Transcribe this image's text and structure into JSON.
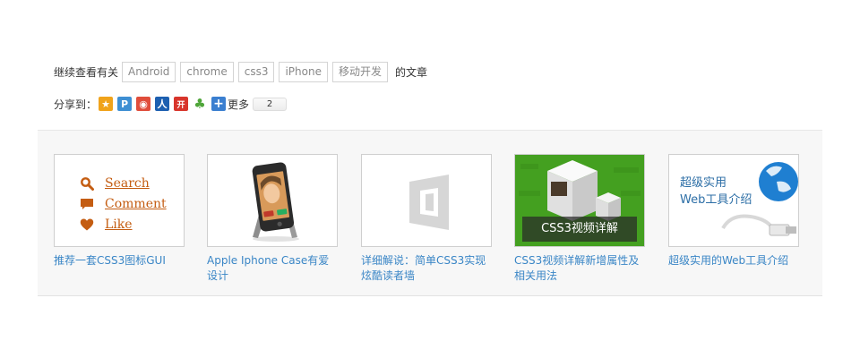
{
  "tags": {
    "prefix": "继续查看有关",
    "items": [
      "Android",
      "chrome",
      "css3",
      "iPhone",
      "移动开发"
    ],
    "suffix": "的文章"
  },
  "share": {
    "label": "分享到：",
    "icons": [
      {
        "name": "qzone-icon",
        "color": "#f0a31b",
        "glyph": "★"
      },
      {
        "name": "tencent-weibo-icon",
        "color": "#3e8fd3",
        "glyph": "P"
      },
      {
        "name": "sina-weibo-icon",
        "color": "#e04d3b",
        "glyph": "◉"
      },
      {
        "name": "renren-icon",
        "color": "#1d5fb0",
        "glyph": "人"
      },
      {
        "name": "kaixin-icon",
        "color": "#d8352c",
        "glyph": "开"
      },
      {
        "name": "clover-icon",
        "color": "#4fa63a",
        "glyph": "♣"
      },
      {
        "name": "more-share-icon",
        "color": "#3b7fd0",
        "glyph": "+"
      }
    ],
    "more_label": "更多",
    "count": "2"
  },
  "related": [
    {
      "caption": "推荐一套CSS3图标GUI",
      "links": [
        "Search",
        "Comment",
        "Like"
      ]
    },
    {
      "caption": "Apple Iphone Case有爱设计"
    },
    {
      "caption": "详细解说：简单CSS3实现炫酷读者墙"
    },
    {
      "caption": "CSS3视频详解新增属性及相关用法",
      "overlay": "CSS3视频详解"
    },
    {
      "caption": "超级实用的Web工具介绍",
      "title_line1": "超级实用",
      "title_line2": "Web工具介绍"
    }
  ]
}
